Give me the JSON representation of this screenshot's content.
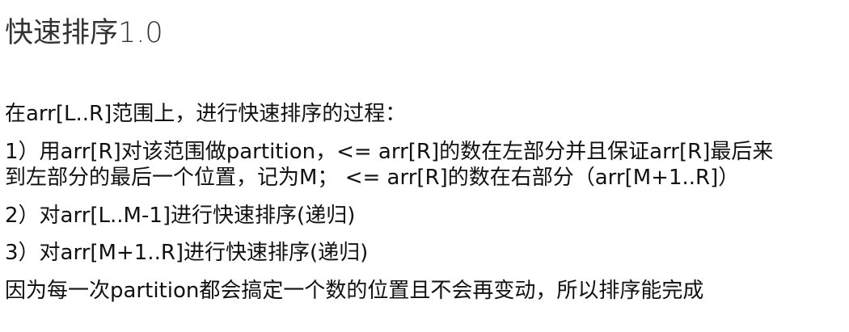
{
  "document": {
    "title": "快速排序1.0",
    "lines": [
      "在arr[L..R]范围上，进行快速排序的过程：",
      "1）用arr[R]对该范围做partition，<= arr[R]的数在左部分并且保证arr[R]最后来",
      "到左部分的最后一个位置，记为M； <= arr[R]的数在右部分（arr[M+1..R]）",
      "2）对arr[L..M-1]进行快速排序(递归)",
      "3）对arr[M+1..R]进行快速排序(递归)",
      "因为每一次partition都会搞定一个数的位置且不会再变动，所以排序能完成"
    ]
  }
}
